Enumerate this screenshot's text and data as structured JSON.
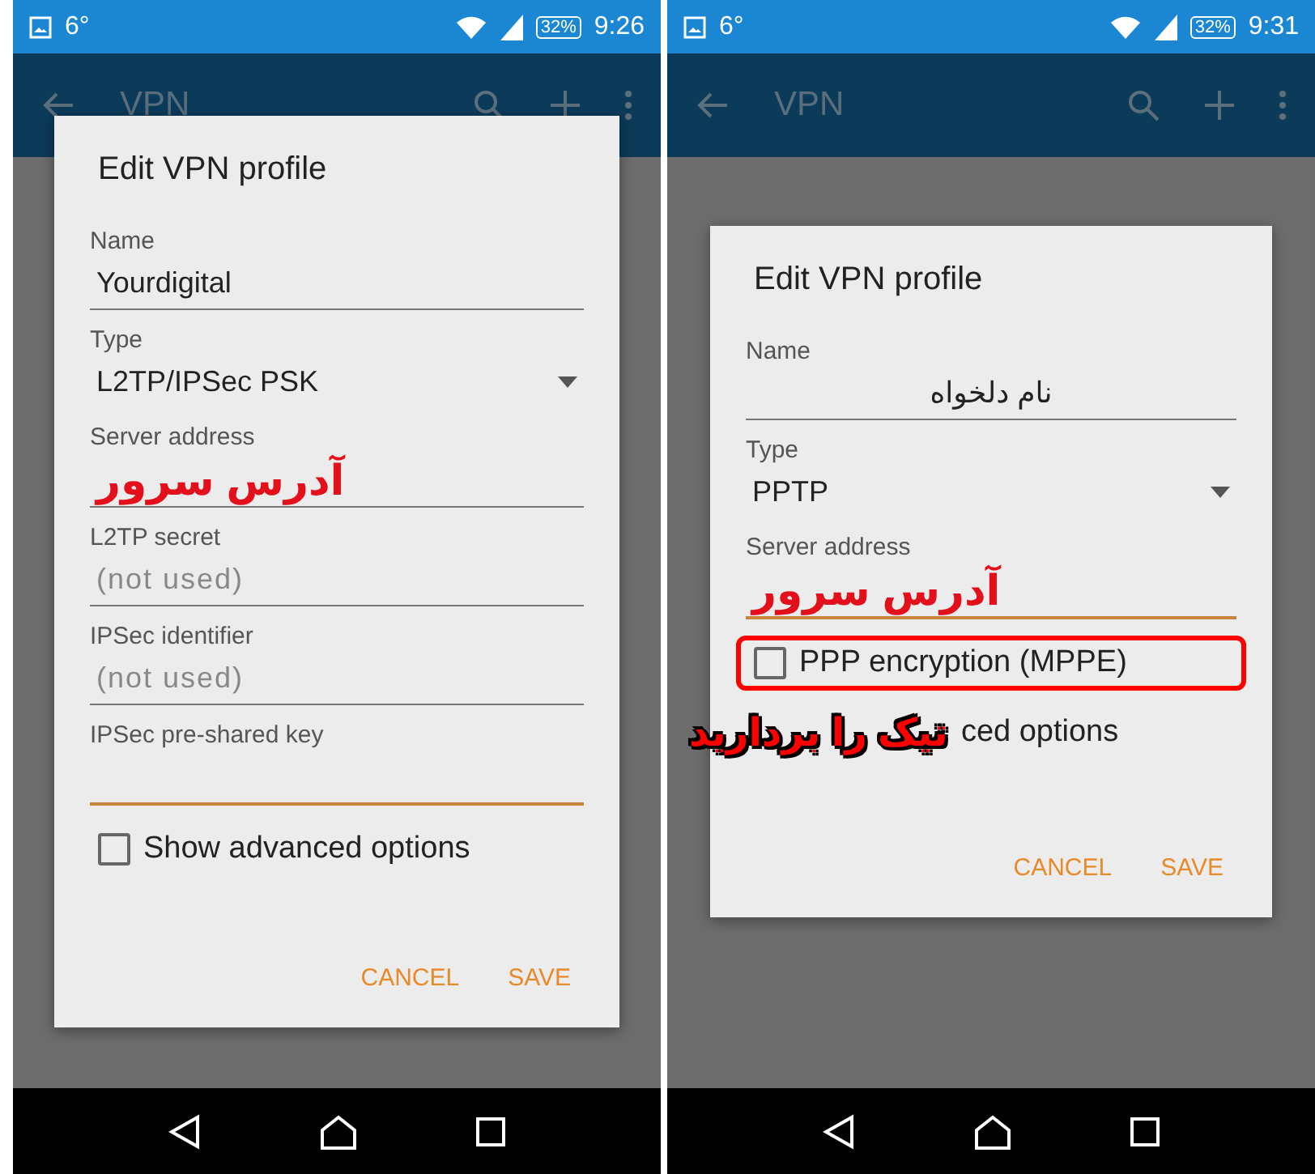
{
  "phones": [
    {
      "status_bar": {
        "temperature": "6°",
        "battery": "32%",
        "time": "9:26"
      },
      "app_bar": {
        "title": "VPN"
      },
      "dialog": {
        "title": "Edit VPN profile",
        "fields": [
          {
            "kind": "text",
            "label": "Name",
            "value": "Yourdigital",
            "focused": false,
            "centered": false
          },
          {
            "kind": "select",
            "label": "Type",
            "value": "L2TP/IPSec PSK"
          },
          {
            "kind": "annotated",
            "label": "Server address",
            "value": "آدرس سرور",
            "focused": false
          },
          {
            "kind": "text",
            "label": "L2TP secret",
            "placeholder": "(not used)",
            "focused": false
          },
          {
            "kind": "text",
            "label": "IPSec identifier",
            "placeholder": "(not used)",
            "focused": false
          },
          {
            "kind": "text",
            "label": "IPSec pre-shared key",
            "focused": true
          }
        ],
        "rows": [
          {
            "kind": "checkbox",
            "label": "Show advanced options",
            "checked": false,
            "highlighted": false
          }
        ],
        "buttons": [
          "CANCEL",
          "SAVE"
        ]
      }
    },
    {
      "status_bar": {
        "temperature": "6°",
        "battery": "32%",
        "time": "9:31"
      },
      "app_bar": {
        "title": "VPN"
      },
      "dialog": {
        "title": "Edit VPN profile",
        "fields": [
          {
            "kind": "text",
            "label": "Name",
            "value": "نام دلخواه",
            "focused": false,
            "centered": true
          },
          {
            "kind": "select",
            "label": "Type",
            "value": "PPTP"
          },
          {
            "kind": "annotated",
            "label": "Server address",
            "value": "آدرس سرور",
            "focused": true
          }
        ],
        "rows": [
          {
            "kind": "checkbox",
            "label": "PPP encryption (MPPE)",
            "checked": false,
            "highlighted": true
          },
          {
            "kind": "covered",
            "label": "ced options",
            "annotation": "تیک را بردارید"
          }
        ],
        "buttons": [
          "CANCEL",
          "SAVE"
        ]
      }
    }
  ]
}
